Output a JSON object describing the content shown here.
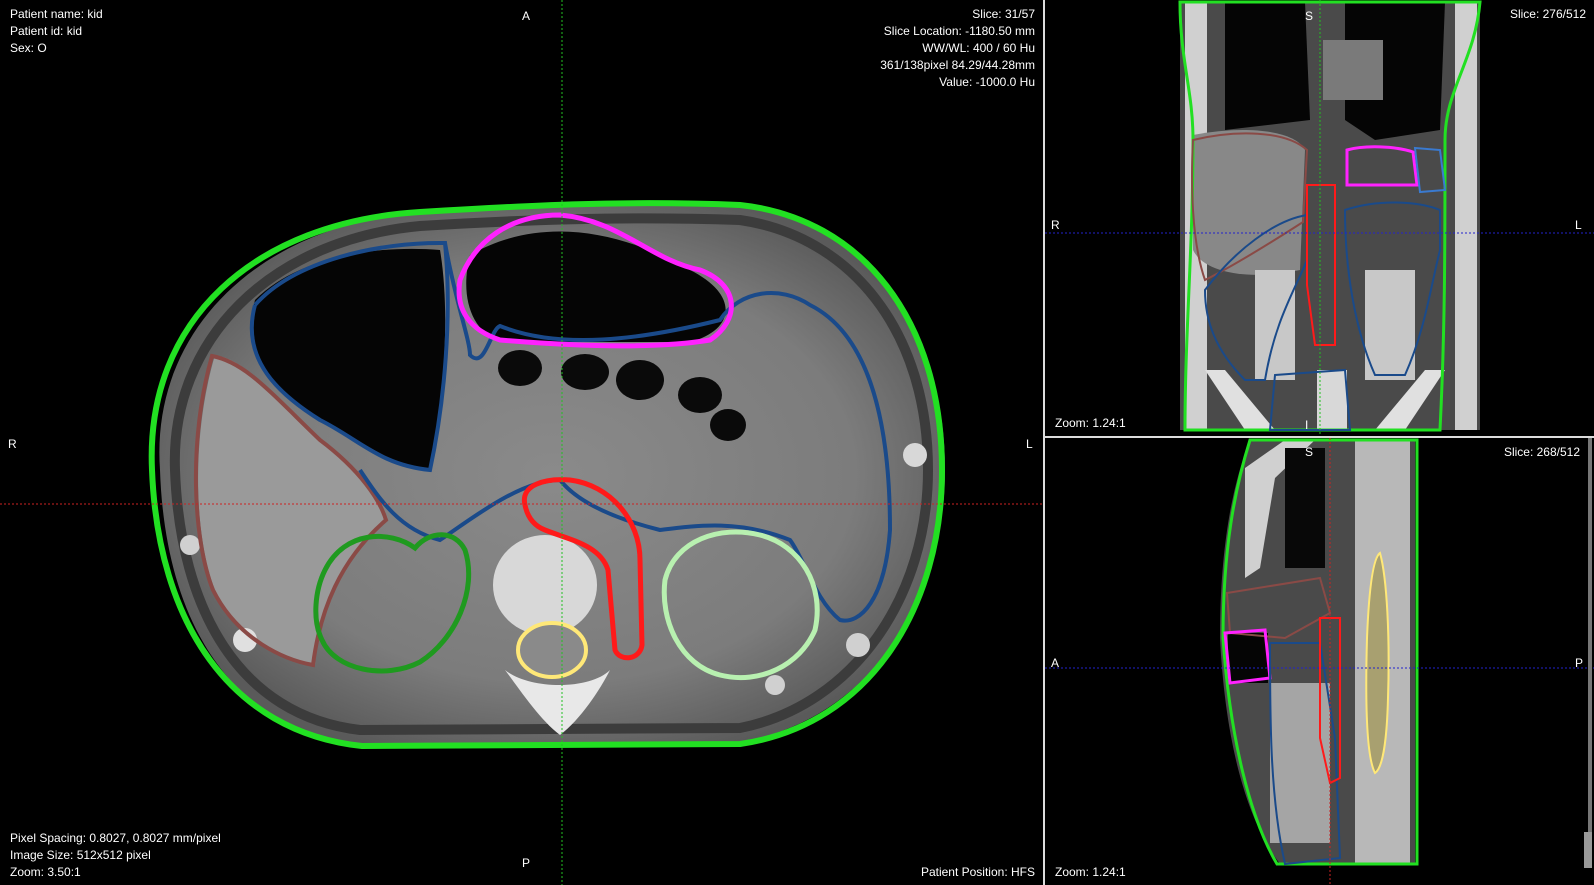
{
  "axial": {
    "patient_name": "Patient name: kid",
    "patient_id": "Patient id: kid",
    "sex": "Sex: O",
    "slice": "Slice: 31/57",
    "slice_location": "Slice Location: -1180.50 mm",
    "ww_wl": "WW/WL: 400 / 60 Hu",
    "pixel_pos": "361/138pixel  84.29/44.28mm",
    "value": "Value: -1000.0 Hu",
    "pixel_spacing": "Pixel Spacing: 0.8027, 0.8027 mm/pixel",
    "image_size": "Image Size: 512x512 pixel",
    "zoom": "Zoom: 3.50:1",
    "patient_position": "Patient Position: HFS",
    "orient_top": "A",
    "orient_bottom": "P",
    "orient_left": "R",
    "orient_right": "L"
  },
  "coronal": {
    "slice": "Slice: 276/512",
    "zoom": "Zoom: 1.24:1",
    "orient_top": "S",
    "orient_bottom": "I",
    "orient_left": "R",
    "orient_right": "L"
  },
  "sagittal": {
    "slice": "Slice: 268/512",
    "zoom": "Zoom: 1.24:1",
    "orient_top": "S",
    "orient_left": "A",
    "orient_right": "P"
  },
  "colors": {
    "body": "#22e022",
    "liver": "#8a4a46",
    "bowel": "#1a4a8a",
    "stomach": "#ff22ff",
    "aorta": "#ff1a1a",
    "kidney_right": "#1f9a1f",
    "kidney_left": "#b8f0b0",
    "spinal_cord": "#ffe878",
    "crosshair_v": "#22c022",
    "crosshair_h": "#cc2222",
    "crosshair_blue": "#2222cc"
  }
}
